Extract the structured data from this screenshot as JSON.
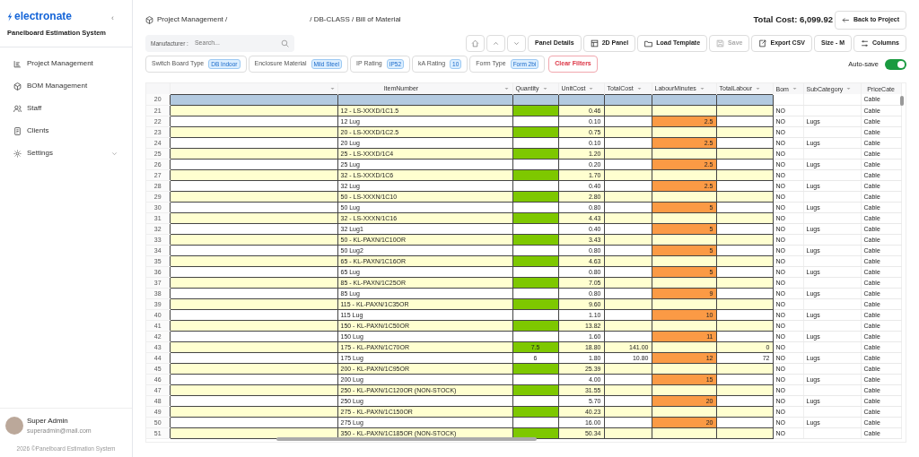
{
  "sidebar": {
    "brand": "electronate",
    "subtitle": "Panelboard Estimation System",
    "collapse_glyph": "‹",
    "items": [
      {
        "label": "Project Management",
        "expandable": false
      },
      {
        "label": "BOM Management",
        "expandable": false
      },
      {
        "label": "Staff",
        "expandable": false
      },
      {
        "label": "Clients",
        "expandable": false
      },
      {
        "label": "Settings",
        "expandable": true
      }
    ],
    "user": {
      "name": "Super Admin",
      "email": "superadmin@mail.com"
    },
    "footer": "2026 ©Panelboard Estimation System"
  },
  "breadcrumb": {
    "start": "Project Management /",
    "end": "/ DB-CLASS / Bill of Material"
  },
  "total_cost": "Total Cost: 6,099.92",
  "back_button": "Back to Project",
  "search": {
    "label": "Manufacturer :",
    "placeholder": "Search..."
  },
  "toolbar": [
    {
      "kind": "icon"
    },
    {
      "kind": "icon"
    },
    {
      "kind": "icon"
    },
    {
      "kind": "text",
      "label": "Panel Details",
      "disabled": false
    },
    {
      "kind": "text",
      "label": "2D Panel",
      "disabled": false
    },
    {
      "kind": "text",
      "label": "Load Template",
      "disabled": false
    },
    {
      "kind": "text",
      "label": "Save",
      "disabled": true
    },
    {
      "kind": "text",
      "label": "Export CSV",
      "disabled": false
    },
    {
      "kind": "text",
      "label": "Size - M",
      "disabled": false
    },
    {
      "kind": "text",
      "label": "Columns",
      "disabled": false
    }
  ],
  "filters": [
    {
      "label": "Switch Board Type",
      "value": "DB Indoor"
    },
    {
      "label": "Enclosure Material",
      "value": "Mild Steel"
    },
    {
      "label": "IP Rating",
      "value": "IP52"
    },
    {
      "label": "kA Rating",
      "value": "10"
    },
    {
      "label": "Form Type",
      "value": "Form 2bi"
    }
  ],
  "clear_filters": "Clear Filters",
  "autosave": {
    "label": "Auto-save",
    "on": true
  },
  "table": {
    "columns": [
      {
        "sortable": true
      },
      {
        "label": "ItemNumber",
        "sortable": true
      },
      {
        "label": "Quantity",
        "sortable": true
      },
      {
        "label": "UnitCost",
        "sortable": true
      },
      {
        "label": "TotalCost",
        "sortable": true
      },
      {
        "label": "LabourMinutes",
        "sortable": true
      },
      {
        "label": "TotalLabour",
        "sortable": true
      },
      {
        "label": "Bom",
        "sortable": true
      },
      {
        "label": "SubCategory",
        "sortable": true
      },
      {
        "label": "PriceCate",
        "sortable": false
      }
    ],
    "rows": [
      {
        "no": "20",
        "kind": "item",
        "selected": true,
        "price": "Cable"
      },
      {
        "no": "21",
        "kind": "item",
        "selected": false,
        "item": "12 - LS-XXXD/1C1.5",
        "unit": "0.46",
        "bom": "NO",
        "price": "Cable"
      },
      {
        "no": "22",
        "kind": "lug",
        "selected": false,
        "item": "12 Lug",
        "unit": "0.10",
        "lm": "2.5",
        "bom": "NO",
        "sub": "Lugs",
        "price": "Cable"
      },
      {
        "no": "23",
        "kind": "item",
        "selected": false,
        "item": "20 - LS-XXXD/1C2.5",
        "unit": "0.75",
        "bom": "NO",
        "price": "Cable"
      },
      {
        "no": "24",
        "kind": "lug",
        "selected": false,
        "item": "20 Lug",
        "unit": "0.10",
        "lm": "2.5",
        "bom": "NO",
        "sub": "Lugs",
        "price": "Cable"
      },
      {
        "no": "25",
        "kind": "item",
        "selected": false,
        "item": "25 - LS-XXXD/1C4",
        "unit": "1.20",
        "bom": "NO",
        "price": "Cable"
      },
      {
        "no": "26",
        "kind": "lug",
        "selected": false,
        "item": "25 Lug",
        "unit": "0.20",
        "lm": "2.5",
        "bom": "NO",
        "sub": "Lugs",
        "price": "Cable"
      },
      {
        "no": "27",
        "kind": "item",
        "selected": false,
        "item": "32 - LS-XXXD/1C6",
        "unit": "1.70",
        "bom": "NO",
        "price": "Cable"
      },
      {
        "no": "28",
        "kind": "lug",
        "selected": false,
        "item": "32 Lug",
        "unit": "0.40",
        "lm": "2.5",
        "bom": "NO",
        "sub": "Lugs",
        "price": "Cable"
      },
      {
        "no": "29",
        "kind": "item",
        "selected": false,
        "item": "50 - LS-XXXN/1C10",
        "unit": "2.80",
        "bom": "NO",
        "price": "Cable"
      },
      {
        "no": "30",
        "kind": "lug",
        "selected": false,
        "item": "50 Lug",
        "unit": "0.80",
        "lm": "5",
        "bom": "NO",
        "sub": "Lugs",
        "price": "Cable"
      },
      {
        "no": "31",
        "kind": "item",
        "selected": false,
        "item": "32 - LS-XXXN/1C16",
        "unit": "4.43",
        "bom": "NO",
        "price": "Cable"
      },
      {
        "no": "32",
        "kind": "lug",
        "selected": false,
        "item": "32 Lug1",
        "unit": "0.40",
        "lm": "5",
        "bom": "NO",
        "sub": "Lugs",
        "price": "Cable"
      },
      {
        "no": "33",
        "kind": "item",
        "selected": false,
        "item": "50 - KL-PAXN/1C10OR",
        "unit": "3.43",
        "bom": "NO",
        "price": "Cable"
      },
      {
        "no": "34",
        "kind": "lug",
        "selected": false,
        "item": "50 Lug2",
        "unit": "0.80",
        "lm": "5",
        "bom": "NO",
        "sub": "Lugs",
        "price": "Cable"
      },
      {
        "no": "35",
        "kind": "item",
        "selected": false,
        "item": "65 - KL-PAXN/1C16OR",
        "unit": "4.63",
        "bom": "NO",
        "price": "Cable"
      },
      {
        "no": "36",
        "kind": "lug",
        "selected": false,
        "item": "65 Lug",
        "unit": "0.80",
        "lm": "5",
        "bom": "NO",
        "sub": "Lugs",
        "price": "Cable"
      },
      {
        "no": "37",
        "kind": "item",
        "selected": false,
        "item": "85 - KL-PAXN/1C25OR",
        "unit": "7.05",
        "bom": "NO",
        "price": "Cable"
      },
      {
        "no": "38",
        "kind": "lug",
        "selected": false,
        "item": "85 Lug",
        "unit": "0.80",
        "lm": "9",
        "bom": "NO",
        "sub": "Lugs",
        "price": "Cable"
      },
      {
        "no": "39",
        "kind": "item",
        "selected": false,
        "item": "115 - KL-PAXN/1C35OR",
        "unit": "9.60",
        "bom": "NO",
        "price": "Cable"
      },
      {
        "no": "40",
        "kind": "lug",
        "selected": false,
        "item": "115 Lug",
        "unit": "1.10",
        "lm": "10",
        "bom": "NO",
        "sub": "Lugs",
        "price": "Cable"
      },
      {
        "no": "41",
        "kind": "item",
        "selected": false,
        "item": "150 - KL-PAXN/1C50OR",
        "unit": "13.82",
        "bom": "NO",
        "price": "Cable"
      },
      {
        "no": "42",
        "kind": "lug",
        "selected": false,
        "item": "150 Lug",
        "unit": "1.60",
        "lm": "11",
        "bom": "NO",
        "sub": "Lugs",
        "price": "Cable"
      },
      {
        "no": "43",
        "kind": "item",
        "selected": false,
        "item": "175 - KL-PAXN/1C70OR",
        "qty": "7.5",
        "unit": "18.80",
        "total": "141.00",
        "tl": "0",
        "bom": "NO",
        "price": "Cable"
      },
      {
        "no": "44",
        "kind": "lug",
        "selected": false,
        "item": "175 Lug",
        "qty": "6",
        "unit": "1.80",
        "total": "10.80",
        "lm": "12",
        "tl": "72",
        "bom": "NO",
        "sub": "Lugs",
        "price": "Cable"
      },
      {
        "no": "45",
        "kind": "item",
        "selected": false,
        "item": "200 - KL-PAXN/1C95OR",
        "unit": "25.39",
        "bom": "NO",
        "price": "Cable"
      },
      {
        "no": "46",
        "kind": "lug",
        "selected": false,
        "item": "200 Lug",
        "unit": "4.00",
        "lm": "15",
        "bom": "NO",
        "sub": "Lugs",
        "price": "Cable"
      },
      {
        "no": "47",
        "kind": "item",
        "selected": false,
        "item": "250 - KL-PAXN/1C120OR (NON-STOCK)",
        "unit": "31.55",
        "bom": "NO",
        "price": "Cable"
      },
      {
        "no": "48",
        "kind": "lug",
        "selected": false,
        "item": "250 Lug",
        "unit": "5.70",
        "lm": "20",
        "bom": "NO",
        "sub": "Lugs",
        "price": "Cable"
      },
      {
        "no": "49",
        "kind": "item",
        "selected": false,
        "item": "275 - KL-PAXN/1C150OR",
        "unit": "40.23",
        "bom": "NO",
        "price": "Cable"
      },
      {
        "no": "50",
        "kind": "lug",
        "selected": false,
        "item": "275 Lug",
        "unit": "16.00",
        "lm": "20",
        "bom": "NO",
        "sub": "Lugs",
        "price": "Cable"
      },
      {
        "no": "51",
        "kind": "item",
        "selected": false,
        "item": "350 - KL-PAXN/1C185OR (NON-STOCK)",
        "unit": "50.34",
        "bom": "NO",
        "price": "Cable"
      }
    ]
  }
}
